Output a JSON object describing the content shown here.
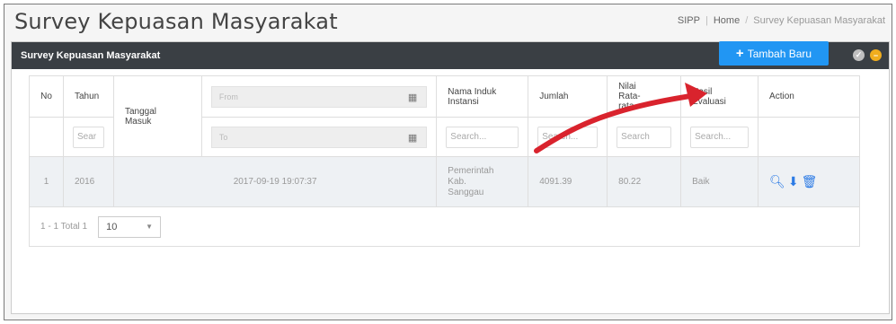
{
  "page": {
    "title": "Survey Kepuasan Masyarakat"
  },
  "breadcrumb": {
    "items": [
      "SIPP",
      "Home",
      "Survey Kepuasan Masyarakat"
    ]
  },
  "panel": {
    "title": "Survey Kepuasan Masyarakat"
  },
  "toolbar": {
    "add_label": "Tambah Baru"
  },
  "table": {
    "headers": {
      "no": "No",
      "tahun": "Tahun",
      "tanggal": "Tanggal\nMasuk",
      "nama": "Nama Induk\nInstansi",
      "jumlah": "Jumlah",
      "nilai": "Nilai\nRata-\nrata",
      "hasil": "Hasil\nEvaluasi",
      "action": "Action"
    },
    "filters": {
      "tahun": "Sear",
      "from": "From",
      "to": "To",
      "nama": "Search...",
      "jumlah": "Search...",
      "nilai": "Search",
      "hasil": "Search..."
    },
    "rows": [
      {
        "no": "1",
        "tahun": "2016",
        "tanggal": "2017-09-19 19:07:37",
        "nama": "Pemerintah\nKab.\nSanggau",
        "jumlah": "4091.39",
        "nilai": "80.22",
        "hasil": "Baik"
      }
    ]
  },
  "pagination": {
    "info": "1 - 1 Total 1",
    "page_size": "10"
  },
  "colors": {
    "header_bar": "#3a3f44",
    "primary": "#2196f3",
    "arrow": "#d9232d"
  }
}
